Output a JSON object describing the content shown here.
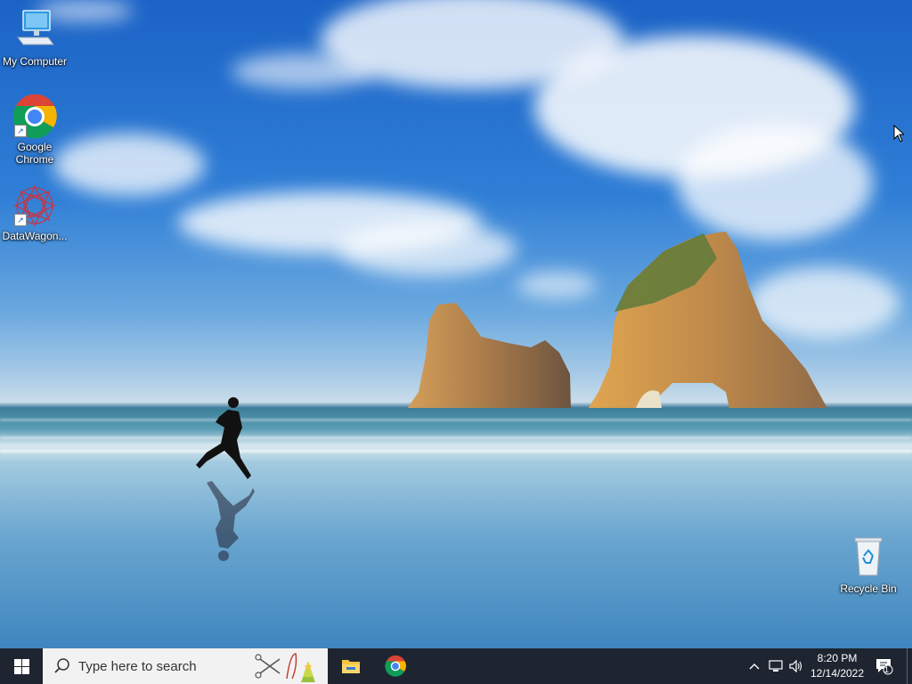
{
  "desktop": {
    "icons": [
      {
        "label": "My Computer",
        "icon": "computer-icon"
      },
      {
        "label": "Google Chrome",
        "icon": "chrome-icon"
      },
      {
        "label": "DataWagon...",
        "icon": "datawagon-icon"
      },
      {
        "label": "Recycle Bin",
        "icon": "recycle-bin-icon"
      }
    ]
  },
  "taskbar": {
    "search_placeholder": "Type here to search",
    "apps": [
      {
        "name": "File Explorer",
        "icon": "file-explorer-icon"
      },
      {
        "name": "Google Chrome",
        "icon": "chrome-icon"
      }
    ],
    "tray": {
      "icons": [
        "chevron-up-icon",
        "network-icon",
        "volume-icon"
      ],
      "time": "8:20 PM",
      "date": "12/14/2022",
      "notification_count": "1"
    }
  },
  "colors": {
    "taskbar_bg": "#1e2531",
    "search_bg": "#f2f2f2",
    "accent": "#0078d7"
  }
}
